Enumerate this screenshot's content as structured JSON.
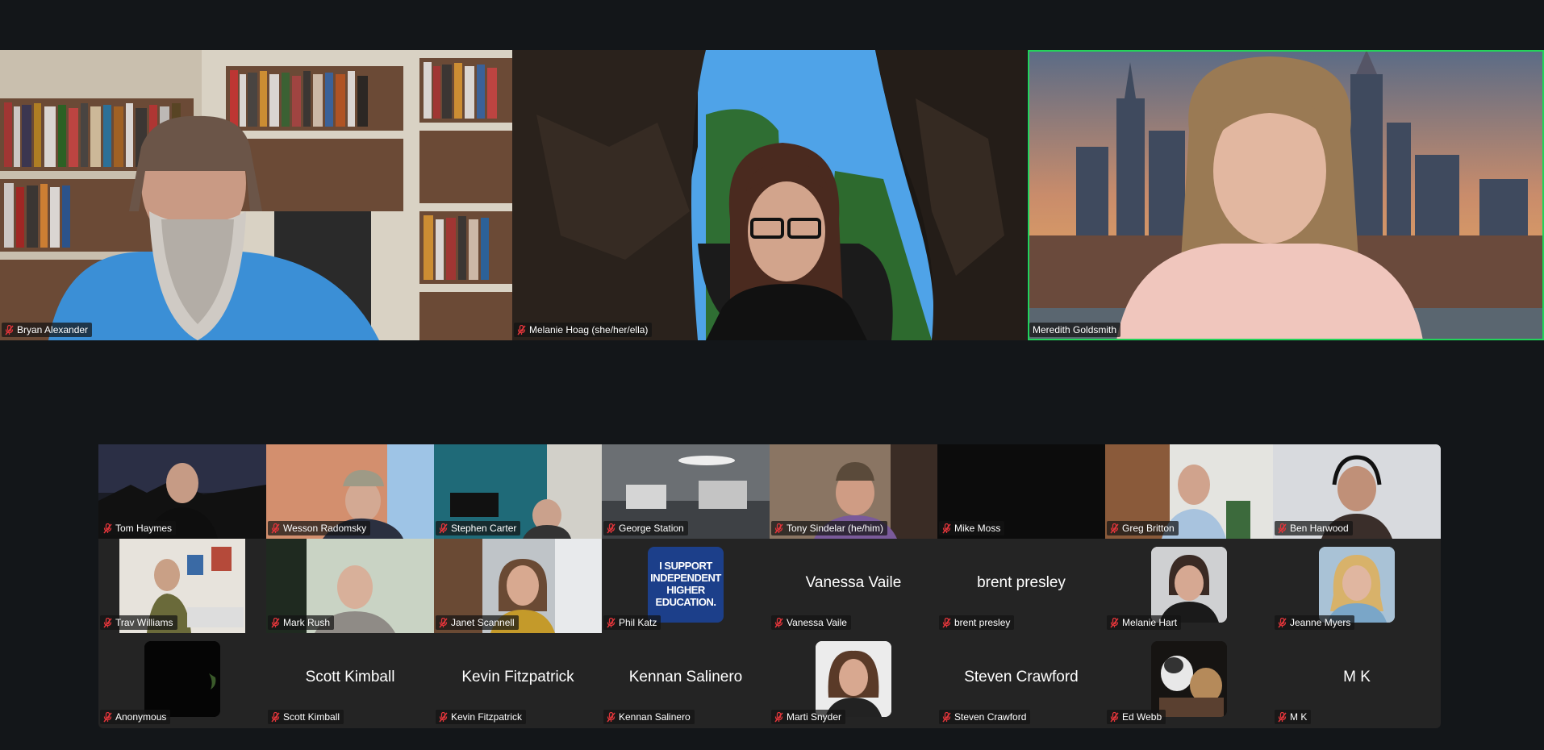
{
  "main_tiles": [
    {
      "name": "Bryan Alexander"
    },
    {
      "name": "Melanie Hoag (she/her/ella)"
    },
    {
      "name": "Meredith Goldsmith"
    }
  ],
  "gallery": {
    "row1": [
      {
        "name": "Tom Haymes"
      },
      {
        "name": "Wesson Radomsky"
      },
      {
        "name": "Stephen Carter"
      },
      {
        "name": "George Station"
      },
      {
        "name": "Tony Sindelar (he/him)"
      },
      {
        "name": "Mike Moss"
      },
      {
        "name": "Greg Britton"
      },
      {
        "name": "Ben Harwood"
      }
    ],
    "row2": [
      {
        "name": "Trav Williams"
      },
      {
        "name": "Mark Rush"
      },
      {
        "name": "Janet Scannell"
      },
      {
        "name": "Phil Katz",
        "avatar_text": [
          "I SUPPORT",
          "INDEPENDENT",
          "HIGHER",
          "EDUCATION."
        ]
      },
      {
        "name": "Vanessa Vaile",
        "display": "Vanessa Vaile"
      },
      {
        "name": "brent presley",
        "display": "brent presley"
      },
      {
        "name": "Melanie Hart"
      },
      {
        "name": "Jeanne Myers"
      }
    ],
    "row3": [
      {
        "name": "Anonymous"
      },
      {
        "name": "Scott Kimball",
        "display": "Scott Kimball"
      },
      {
        "name": "Kevin Fitzpatrick",
        "display": "Kevin Fitzpatrick"
      },
      {
        "name": "Kennan Salinero",
        "display": "Kennan Salinero"
      },
      {
        "name": "Marti Snyder"
      },
      {
        "name": "Steven Crawford",
        "display": "Steven Crawford"
      },
      {
        "name": "Ed Webb"
      },
      {
        "name": "M K",
        "display": "M K"
      }
    ]
  },
  "colors": {
    "background": "#131619",
    "gallery_bg": "#242424",
    "active_speaker": "#23d35a",
    "mic_muted": "#e0353a"
  },
  "icons": {
    "mic": "mic-muted-icon"
  }
}
